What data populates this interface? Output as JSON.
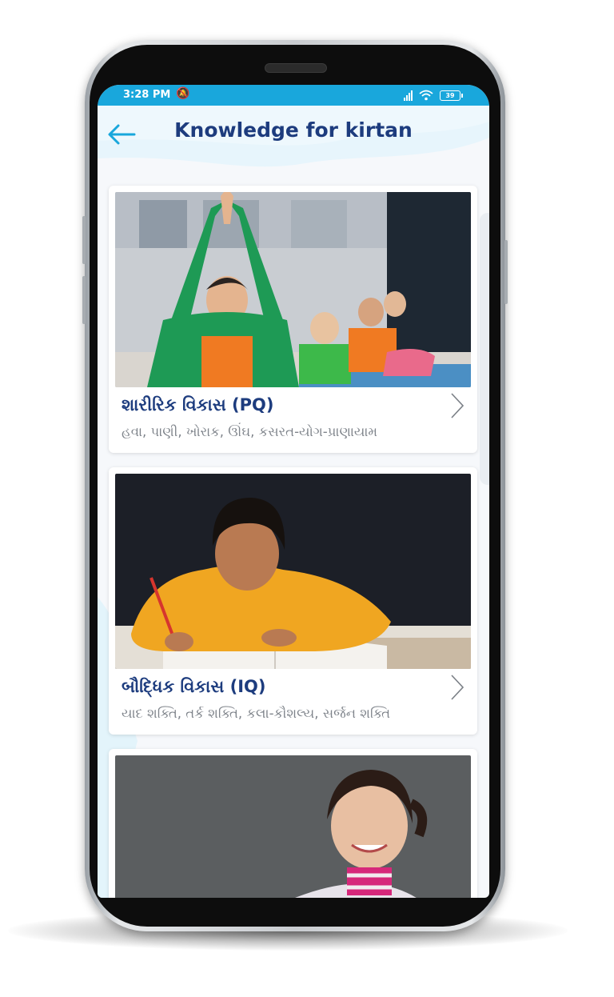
{
  "status_bar": {
    "time": "3:28 PM",
    "mute_icon": "bell-off-icon",
    "battery": "39"
  },
  "header": {
    "title": "Knowledge for kirtan",
    "back_icon": "arrow-left-icon"
  },
  "cards": [
    {
      "title": "શારીરિક વિકાસ (PQ)",
      "subtitle": "હવા, પાણી, ખોરાક, ઊંઘ, કસરત-યોગ-પ્રાણાયામ",
      "image": "children-yoga-photo"
    },
    {
      "title": "બૌદ્ધિક વિકાસ (IQ)",
      "subtitle": "યાદ શક્તિ, તર્ક શક્તિ, કલા-કૌશલ્ય, સર્જન શક્તિ",
      "image": "boy-writing-photo"
    },
    {
      "title": "",
      "subtitle": "",
      "image": "smiling-girl-photo"
    }
  ],
  "colors": {
    "accent": "#19a7dc",
    "title": "#1d3c7e",
    "subtitle": "#7e838a"
  }
}
